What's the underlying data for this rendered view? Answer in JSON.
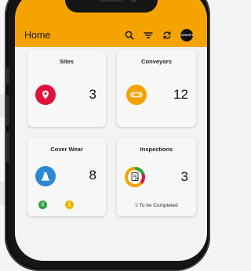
{
  "app": {
    "title": "Home",
    "avatar_text": "CONVEY"
  },
  "colors": {
    "accent": "#f5a300",
    "sites": "#e0123a",
    "conveyors": "#f5a300",
    "cover_wear": "#2b88d6",
    "badge_green": "#2ea043",
    "badge_yellow": "#f0b400"
  },
  "icons": {
    "search": "search-icon",
    "filter": "filter-icon",
    "sync": "sync-icon"
  },
  "cards": {
    "sites": {
      "title": "Sites",
      "value": "3"
    },
    "conveyors": {
      "title": "Conveyors",
      "value": "12"
    },
    "cover_wear": {
      "title": "Cover Wear",
      "value": "8",
      "badge_green": "2",
      "badge_yellow": "1"
    },
    "inspections": {
      "title": "Inspections",
      "value": "3",
      "pending_count": "9",
      "pending_text": " To be Completed"
    }
  }
}
